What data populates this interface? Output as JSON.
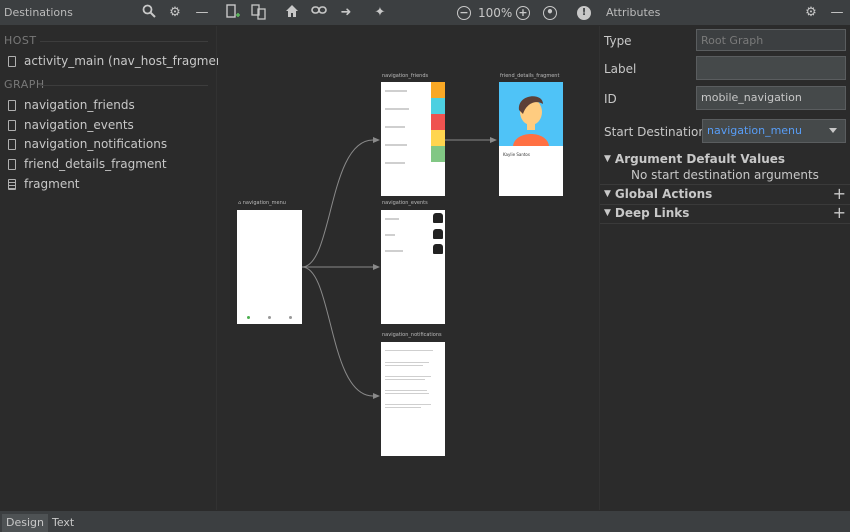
{
  "toolbar": {
    "destinations_title": "Destinations",
    "zoom": "100%",
    "attributes_title": "Attributes"
  },
  "left": {
    "host_header": "HOST",
    "host_item": "activity_main (nav_host_fragment)",
    "graph_header": "GRAPH",
    "items": [
      "navigation_friends",
      "navigation_events",
      "navigation_notifications",
      "friend_details_fragment",
      "fragment"
    ]
  },
  "canvas": {
    "menu_label": "navigation_menu",
    "friends_label": "navigation_friends",
    "events_label": "navigation_events",
    "notifications_label": "navigation_notifications",
    "details_label": "friend_details_fragment",
    "details_name": "Kaylie Santos"
  },
  "attributes": {
    "type_label": "Type",
    "type_value": "Root Graph",
    "label_label": "Label",
    "label_value": "",
    "id_label": "ID",
    "id_value": "mobile_navigation",
    "start_label": "Start Destination",
    "start_value": "navigation_menu",
    "arg_defaults": "Argument Default Values",
    "arg_note": "No start destination arguments",
    "global_actions": "Global Actions",
    "deep_links": "Deep Links"
  },
  "bottom_tabs": [
    "Design",
    "Text"
  ],
  "colors": {
    "accent_link": "#589df6",
    "background": "#2b2b2b",
    "toolbar": "#3c3f41"
  },
  "icons": [
    "search-icon",
    "gear-icon",
    "minus-icon",
    "new-destination-icon",
    "nested-graph-icon",
    "home-icon",
    "link-icon",
    "arrow-right-icon",
    "auto-arrange-icon",
    "zoom-out-icon",
    "zoom-in-icon",
    "zoom-fit-icon",
    "warning-icon"
  ]
}
